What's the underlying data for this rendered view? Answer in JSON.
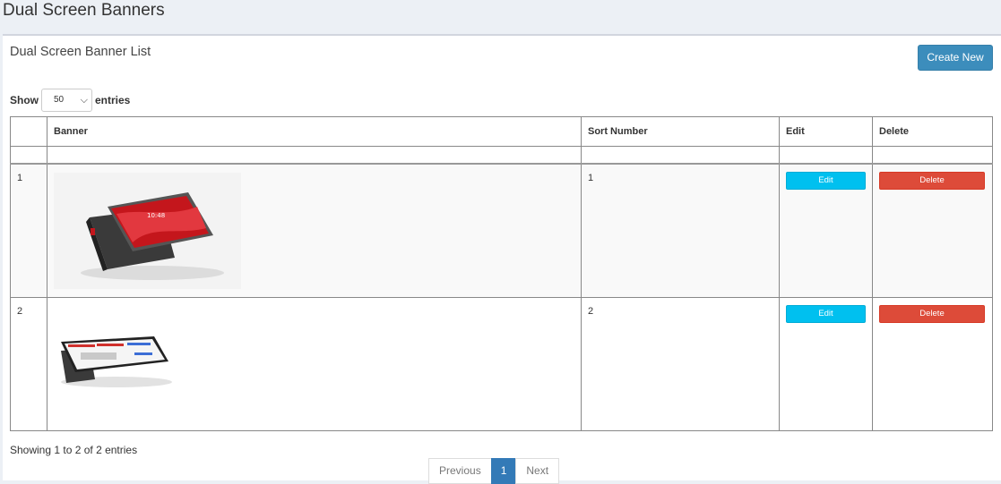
{
  "page": {
    "title": "Dual Screen Banners"
  },
  "box": {
    "title": "Dual Screen Banner List",
    "create_label": "Create New"
  },
  "length": {
    "show_label": "Show",
    "selected": "50",
    "entries_label": "entries"
  },
  "table": {
    "headers": [
      "",
      "Banner",
      "Sort Number",
      "Edit",
      "Delete"
    ],
    "rows": [
      {
        "index": "1",
        "sort": "1",
        "edit_label": "Edit",
        "delete_label": "Delete",
        "banner_icon": "pos-terminal-red-screen-image"
      },
      {
        "index": "2",
        "sort": "2",
        "edit_label": "Edit",
        "delete_label": "Delete",
        "banner_icon": "pos-terminal-dark-image"
      }
    ]
  },
  "footer": {
    "info": "Showing 1 to 2 of 2 entries",
    "prev_label": "Previous",
    "page_label": "1",
    "next_label": "Next"
  },
  "colors": {
    "primary": "#3c8dbc",
    "info": "#00c0ef",
    "danger": "#dd4b39"
  }
}
